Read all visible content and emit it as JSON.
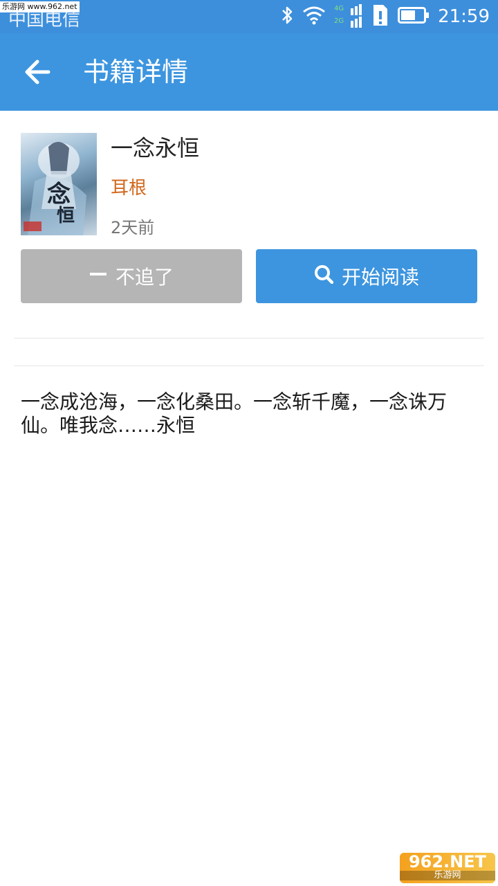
{
  "status_bar": {
    "carrier": "中国电信",
    "site_watermark": "乐游网 www.962.net",
    "net_4g": "4G",
    "net_2g": "2G",
    "time": "21:59"
  },
  "app_bar": {
    "title": "书籍详情"
  },
  "book": {
    "title": "一念永恒",
    "author": "耳根",
    "updated": "2天前"
  },
  "actions": {
    "unfollow_label": "不追了",
    "read_label": "开始阅读"
  },
  "intro": "一念成沧海，一念化桑田。一念斩千魔，一念诛万仙。唯我念……永恒",
  "footer_watermark": {
    "brand": "962.NET",
    "sub": "乐游网"
  },
  "colors": {
    "primary": "#3d95df",
    "author": "#d2691e",
    "disabled_button": "#b5b5b5"
  }
}
